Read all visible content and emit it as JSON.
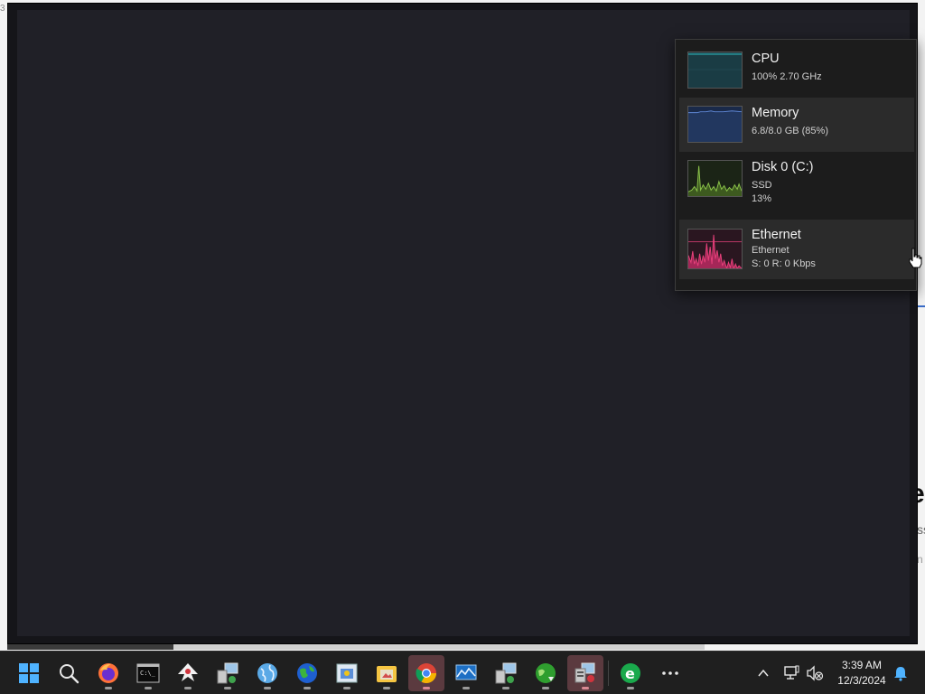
{
  "background": {
    "big_letter": "e",
    "small_text_1": "ss",
    "small_text_2": "n",
    "top_char": "3"
  },
  "perf_panel": {
    "items": [
      {
        "title": "CPU",
        "sub1": "100%  2.70 GHz",
        "sub2": "",
        "graph_color": "#2fb3b8",
        "graph_fill": "#1a3c44"
      },
      {
        "title": "Memory",
        "sub1": "6.8/8.0 GB (85%)",
        "sub2": "",
        "graph_color": "#5f87d6",
        "graph_fill": "#1a2a4a"
      },
      {
        "title": "Disk 0 (C:)",
        "sub1": "SSD",
        "sub2": "13%",
        "graph_color": "#8bc34a",
        "graph_fill": "#1b2416"
      },
      {
        "title": "Ethernet",
        "sub1": "Ethernet",
        "sub2": "S: 0  R: 0 Kbps",
        "graph_color": "#e6407a",
        "graph_fill": "#2a1620"
      }
    ],
    "selected_index": 1,
    "hovered_index": 3
  },
  "taskbar": {
    "apps": [
      {
        "name": "start-icon"
      },
      {
        "name": "search-icon"
      },
      {
        "name": "firefox-icon"
      },
      {
        "name": "terminal-icon"
      },
      {
        "name": "inkscape-icon"
      },
      {
        "name": "remote-desktop-icon"
      },
      {
        "name": "globe-browser-icon"
      },
      {
        "name": "world-globe-icon"
      },
      {
        "name": "image-viewer-icon"
      },
      {
        "name": "folder-image-icon"
      },
      {
        "name": "chrome-icon",
        "active": true
      },
      {
        "name": "monitor-graph-icon"
      },
      {
        "name": "network-computer-icon"
      },
      {
        "name": "globe-connect-icon"
      },
      {
        "name": "task-manager-icon",
        "active": true
      },
      {
        "name": "edge-legacy-icon"
      },
      {
        "name": "more-apps-icon"
      }
    ],
    "clock_time": "3:39 AM",
    "clock_date": "12/3/2024"
  }
}
